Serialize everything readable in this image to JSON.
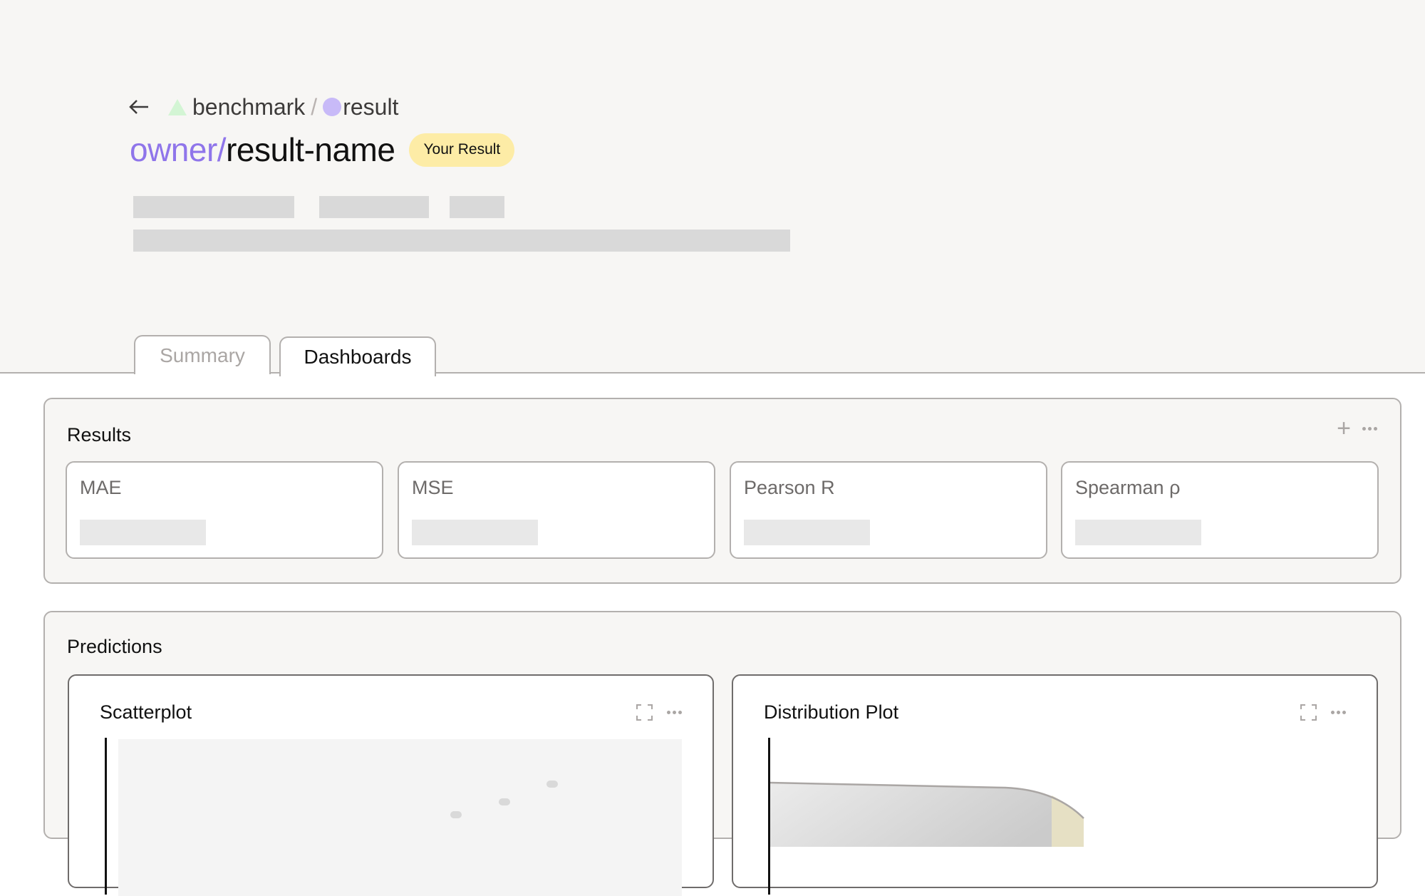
{
  "breadcrumb": {
    "back_icon": "arrow-left-icon",
    "benchmark_icon": "triangle-icon",
    "benchmark_label": "benchmark",
    "separator": "/",
    "result_icon": "circle-icon",
    "result_label": "result"
  },
  "header": {
    "owner": "owner/",
    "name": "result-name",
    "badge": "Your Result"
  },
  "tabs": [
    {
      "label": "Summary",
      "active": false
    },
    {
      "label": "Dashboards",
      "active": true
    }
  ],
  "results_panel": {
    "title": "Results",
    "add_icon": "plus-icon",
    "more_icon": "more-horizontal-icon",
    "metrics": [
      {
        "label": "MAE"
      },
      {
        "label": "MSE"
      },
      {
        "label": "Pearson R"
      },
      {
        "label": "Spearman ρ"
      }
    ]
  },
  "predictions_panel": {
    "title": "Predictions",
    "charts": [
      {
        "title": "Scatterplot",
        "expand_icon": "expand-icon",
        "more_icon": "more-horizontal-icon"
      },
      {
        "title": "Distribution Plot",
        "expand_icon": "expand-icon",
        "more_icon": "more-horizontal-icon"
      }
    ]
  },
  "colors": {
    "accent": "#8f75ea",
    "badge_bg": "#fdeca6",
    "benchmark_icon": "#d3f5d4",
    "result_icon": "#c8baf8",
    "header_bg": "#f7f6f4"
  }
}
